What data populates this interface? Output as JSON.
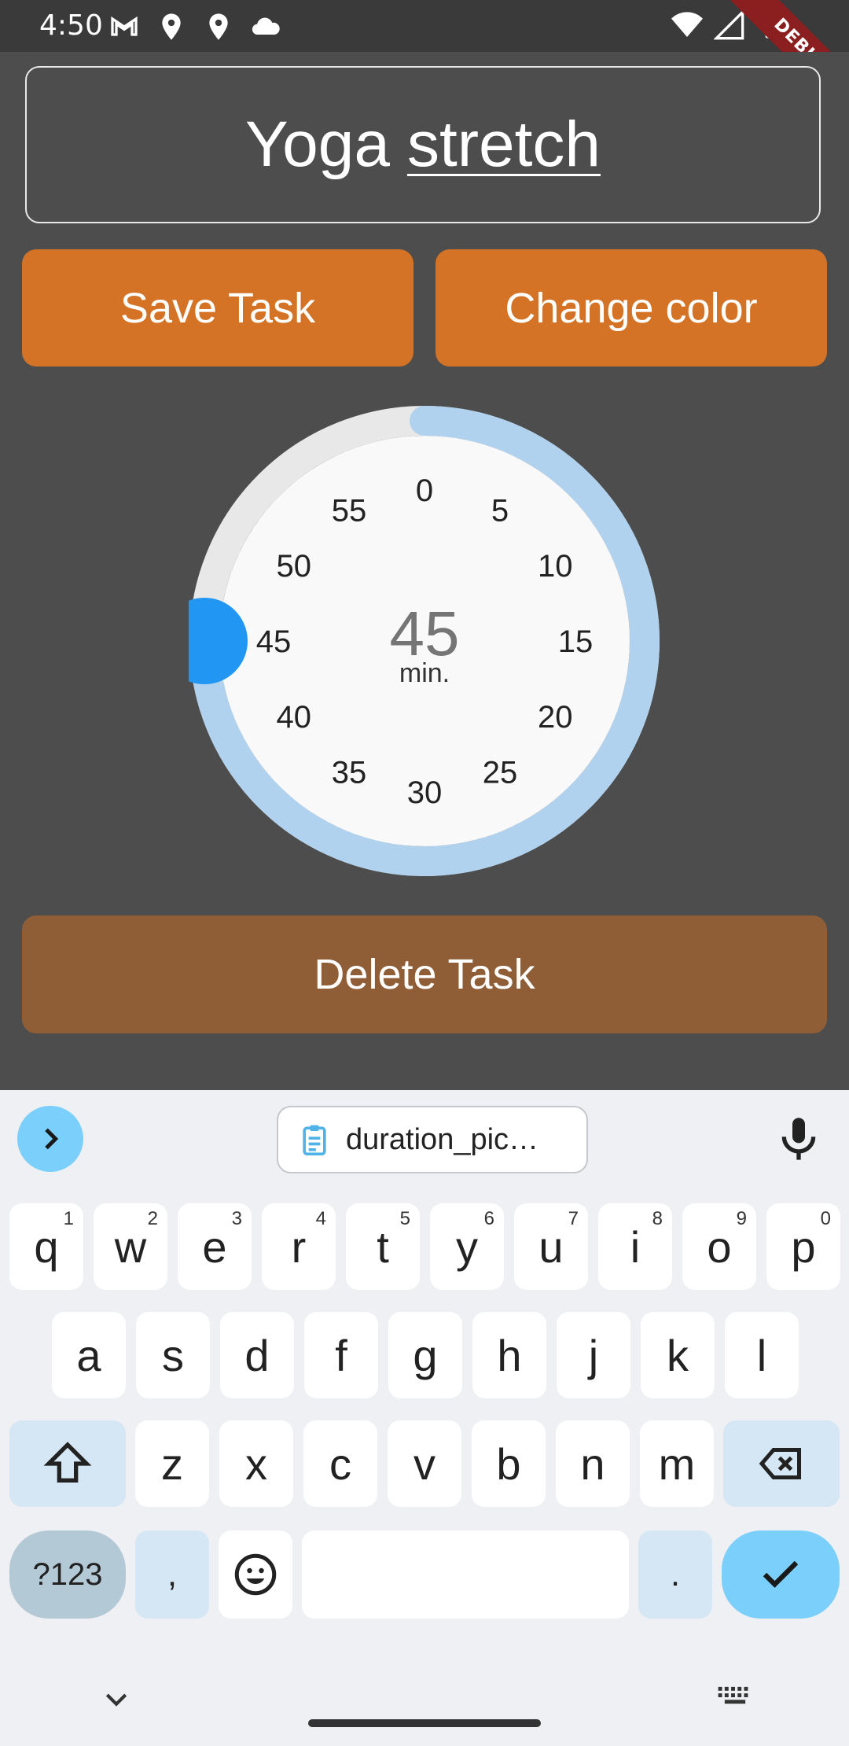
{
  "status_bar": {
    "time": "4:50",
    "left_icons": [
      "gmail-icon",
      "location-icon",
      "location-icon",
      "cloud-icon"
    ],
    "right_icons": [
      "wifi-icon",
      "signal-icon",
      "battery-icon"
    ],
    "debug_label": "DEBUG"
  },
  "task": {
    "title_part1": "Yoga",
    "title_part2": "stretch"
  },
  "buttons": {
    "save": "Save Task",
    "change_color": "Change color",
    "delete": "Delete Task"
  },
  "duration_picker": {
    "value": "45",
    "unit": "min.",
    "value_minutes": 45,
    "ticks": [
      "0",
      "5",
      "10",
      "15",
      "20",
      "25",
      "30",
      "35",
      "40",
      "45",
      "50",
      "55"
    ],
    "colors": {
      "track": "#e8e8e8",
      "progress": "#b0d2ee",
      "handle": "#2196f3",
      "face": "#f9f9f9"
    }
  },
  "keyboard": {
    "clipboard_text": "duration_pic…",
    "row1": [
      {
        "k": "q",
        "s": "1"
      },
      {
        "k": "w",
        "s": "2"
      },
      {
        "k": "e",
        "s": "3"
      },
      {
        "k": "r",
        "s": "4"
      },
      {
        "k": "t",
        "s": "5"
      },
      {
        "k": "y",
        "s": "6"
      },
      {
        "k": "u",
        "s": "7"
      },
      {
        "k": "i",
        "s": "8"
      },
      {
        "k": "o",
        "s": "9"
      },
      {
        "k": "p",
        "s": "0"
      }
    ],
    "row2": [
      "a",
      "s",
      "d",
      "f",
      "g",
      "h",
      "j",
      "k",
      "l"
    ],
    "row3": [
      "z",
      "x",
      "c",
      "v",
      "b",
      "n",
      "m"
    ],
    "num_key": "?123",
    "comma": ",",
    "period": "."
  }
}
